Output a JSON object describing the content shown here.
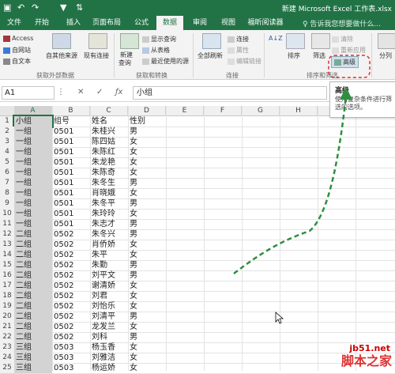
{
  "title_bar": {
    "doc_title": "新建 Microsoft Excel 工作表.xlsx"
  },
  "tabs": [
    "文件",
    "开始",
    "插入",
    "页面布局",
    "公式",
    "数据",
    "审阅",
    "视图",
    "福昕阅读器"
  ],
  "tell_me": "♀ 告诉我您想要做什么...",
  "ribbon": {
    "get_external": {
      "access": "Access",
      "web": "自网站",
      "text": "自文本",
      "other": "自其他来源",
      "existing": "现有连接",
      "label": "获取外部数据"
    },
    "transform": {
      "new_query": "新建",
      "new_query2": "查询",
      "show_query": "显示查询",
      "from_table": "从表格",
      "recent": "最近使用的源",
      "label": "获取和转换"
    },
    "connections": {
      "refresh": "全部刷新",
      "connections": "连接",
      "properties": "属性",
      "edit_links": "编辑链接",
      "label": "连接"
    },
    "sort_filter": {
      "sort_az": "A↓Z",
      "sort": "排序",
      "filter": "筛选",
      "clear": "清除",
      "reapply": "重新应用",
      "advanced": "高级",
      "label": "排序和筛选"
    },
    "split": "分列"
  },
  "formula_bar": {
    "name_box": "A1",
    "content": "小组"
  },
  "tooltip": {
    "title": "高级",
    "text": "使用复杂条件进行筛选的选项。"
  },
  "columns": [
    "A",
    "B",
    "C",
    "D",
    "E",
    "F",
    "G",
    "H"
  ],
  "rows": [
    [
      "小组",
      "组号",
      "姓名",
      "性别"
    ],
    [
      "一组",
      "0501",
      "朱桂兴",
      "男"
    ],
    [
      "一组",
      "0501",
      "陈四姑",
      "女"
    ],
    [
      "一组",
      "0501",
      "朱陈红",
      "女"
    ],
    [
      "一组",
      "0501",
      "朱龙艳",
      "女"
    ],
    [
      "一组",
      "0501",
      "朱陈奇",
      "女"
    ],
    [
      "一组",
      "0501",
      "朱冬生",
      "男"
    ],
    [
      "一组",
      "0501",
      "肖晓娥",
      "女"
    ],
    [
      "一组",
      "0501",
      "朱冬平",
      "男"
    ],
    [
      "一组",
      "0501",
      "朱玲玲",
      "女"
    ],
    [
      "一组",
      "0501",
      "朱志才",
      "男"
    ],
    [
      "二组",
      "0502",
      "朱冬兴",
      "男"
    ],
    [
      "二组",
      "0502",
      "肖侨娇",
      "女"
    ],
    [
      "二组",
      "0502",
      "朱平",
      "女"
    ],
    [
      "二组",
      "0502",
      "朱勤",
      "男"
    ],
    [
      "二组",
      "0502",
      "刘平文",
      "男"
    ],
    [
      "二组",
      "0502",
      "谢清娇",
      "女"
    ],
    [
      "二组",
      "0502",
      "刘君",
      "女"
    ],
    [
      "二组",
      "0502",
      "刘怡乐",
      "女"
    ],
    [
      "二组",
      "0502",
      "刘清平",
      "男"
    ],
    [
      "二组",
      "0502",
      "龙发兰",
      "女"
    ],
    [
      "二组",
      "0502",
      "刘科",
      "男"
    ],
    [
      "三组",
      "0503",
      "杨玉香",
      "女"
    ],
    [
      "三组",
      "0503",
      "刘雅洁",
      "女"
    ],
    [
      "三组",
      "0503",
      "杨运娇",
      "女"
    ],
    [
      "三组",
      "0503",
      "邱会書",
      "女"
    ]
  ],
  "watermark": {
    "site": "jb51.net",
    "name": "脚本之家"
  }
}
